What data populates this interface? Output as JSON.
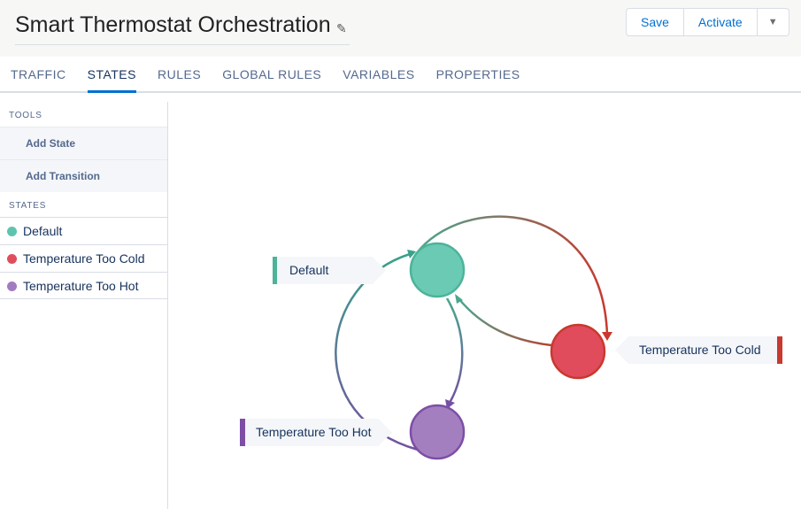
{
  "header": {
    "title": "Smart Thermostat Orchestration",
    "edit_icon": "pencil-icon",
    "save": "Save",
    "activate": "Activate",
    "menu_icon": "caret-down-icon"
  },
  "tabs": [
    {
      "label": "TRAFFIC"
    },
    {
      "label": "STATES",
      "active": true
    },
    {
      "label": "RULES"
    },
    {
      "label": "GLOBAL RULES"
    },
    {
      "label": "VARIABLES"
    },
    {
      "label": "PROPERTIES"
    }
  ],
  "sidebar": {
    "tools_heading": "TOOLS",
    "tools": [
      "Add State",
      "Add Transition"
    ],
    "states_heading": "STATES",
    "states": [
      {
        "label": "Default",
        "color": "#5fc4ad"
      },
      {
        "label": "Temperature Too Cold",
        "color": "#e04e5e"
      },
      {
        "label": "Temperature Too Hot",
        "color": "#a27cc0"
      }
    ]
  },
  "diagram": {
    "nodes": [
      {
        "label": "Default",
        "color": "#6bcab3"
      },
      {
        "label": "Temperature Too Cold",
        "color": "#e04c5c"
      },
      {
        "label": "Temperature Too Hot",
        "color": "#a47fc0"
      }
    ],
    "transitions": [
      {
        "from": "Default",
        "to": "Temperature Too Cold"
      },
      {
        "from": "Temperature Too Cold",
        "to": "Default"
      },
      {
        "from": "Default",
        "to": "Temperature Too Hot"
      },
      {
        "from": "Temperature Too Hot",
        "to": "Default"
      }
    ]
  }
}
